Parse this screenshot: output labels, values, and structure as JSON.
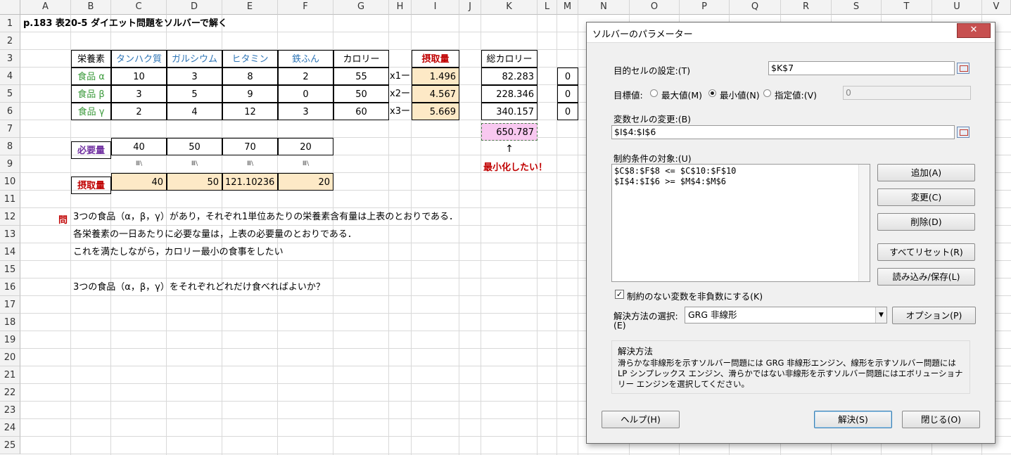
{
  "columns": [
    "A",
    "B",
    "C",
    "D",
    "E",
    "F",
    "G",
    "H",
    "I",
    "J",
    "K",
    "L",
    "M",
    "N",
    "O",
    "P",
    "Q",
    "R",
    "S",
    "T",
    "U",
    "V"
  ],
  "rows": [
    "1",
    "2",
    "3",
    "4",
    "5",
    "6",
    "7",
    "8",
    "9",
    "10",
    "11",
    "12",
    "13",
    "14",
    "15",
    "16",
    "17",
    "18",
    "19",
    "20",
    "21",
    "22",
    "23",
    "24",
    "25"
  ],
  "title": "p.183 表20-5 ダイエット問題をソルバーで解く",
  "table": {
    "corner": "栄養素",
    "headers": [
      "タンハク質",
      "ガルシウム",
      "ヒタミン",
      "鉄ふん",
      "カロリー"
    ],
    "foods": [
      {
        "name": "食品 α",
        "values": [
          "10",
          "3",
          "8",
          "2",
          "55"
        ],
        "var": "x1ー",
        "intake": "1.496",
        "total": "82.283",
        "m": "0"
      },
      {
        "name": "食品 β",
        "values": [
          "3",
          "5",
          "9",
          "0",
          "50"
        ],
        "var": "x2ー",
        "intake": "4.567",
        "total": "228.346",
        "m": "0"
      },
      {
        "name": "食品 γ",
        "values": [
          "2",
          "4",
          "12",
          "3",
          "60"
        ],
        "var": "x3ー",
        "intake": "5.669",
        "total": "340.157",
        "m": "0"
      }
    ],
    "intake_header": "摂取量",
    "total_header": "総カロリー",
    "total_sum": "650.787",
    "arrow": "↑",
    "minimize_note": "最小化したい！",
    "required_label": "必要量",
    "required": [
      "40",
      "50",
      "70",
      "20"
    ],
    "geq": [
      "Ⅲ\\",
      "Ⅲ\\",
      "Ⅲ\\",
      "Ⅲ\\"
    ],
    "intake_label": "摂取量",
    "intake_row": [
      "40",
      "50",
      "121.10236",
      "20"
    ]
  },
  "problem": {
    "mark": "問",
    "lines": [
      "3つの食品（α，β，γ）があり，それぞれ1単位あたりの栄養素含有量は上表のとおりである．",
      "各栄養素の一日あたりに必要な量は，上表の必要量のとおりである．",
      "これを満たしながら，カロリー最小の食事をしたい",
      "",
      "3つの食品（α，β，γ）をそれぞれどれだけ食べればよいか？"
    ]
  },
  "dialog": {
    "title": "ソルバーのパラメーター",
    "close": "✕",
    "objective_label": "目的セルの設定:(T)",
    "objective_value": "$K$7",
    "to_label": "目標値:",
    "opt_max": "最大値(M)",
    "opt_min": "最小値(N)",
    "opt_value": "指定値:(V)",
    "value_of": "0",
    "selected": "min",
    "changing_label": "変数セルの変更:(B)",
    "changing_value": "$I$4:$I$6",
    "constraints_label": "制約条件の対象:(U)",
    "constraints": [
      "$C$8:$F$8 <= $C$10:$F$10",
      "$I$4:$I$6 >= $M$4:$M$6"
    ],
    "btn_add": "追加(A)",
    "btn_change": "変更(C)",
    "btn_delete": "削除(D)",
    "btn_reset": "すべてリセット(R)",
    "btn_load": "読み込み/保存(L)",
    "nonneg_label": "制約のない変数を非負数にする(K)",
    "nonneg_checked": true,
    "method_label_1": "解決方法の選択:",
    "method_label_2": "(E)",
    "method_value": "GRG 非線形",
    "btn_options": "オプション(P)",
    "method_group": "解決方法",
    "method_desc": "滑らかな非線形を示すソルバー問題には GRG 非線形エンジン、線形を示すソルバー問題には LP シンプレックス エンジン、滑らかではない非線形を示すソルバー問題にはエボリューショナリー エンジンを選択してください。",
    "btn_help": "ヘルプ(H)",
    "btn_solve": "解決(S)",
    "btn_close": "閉じる(O)"
  }
}
